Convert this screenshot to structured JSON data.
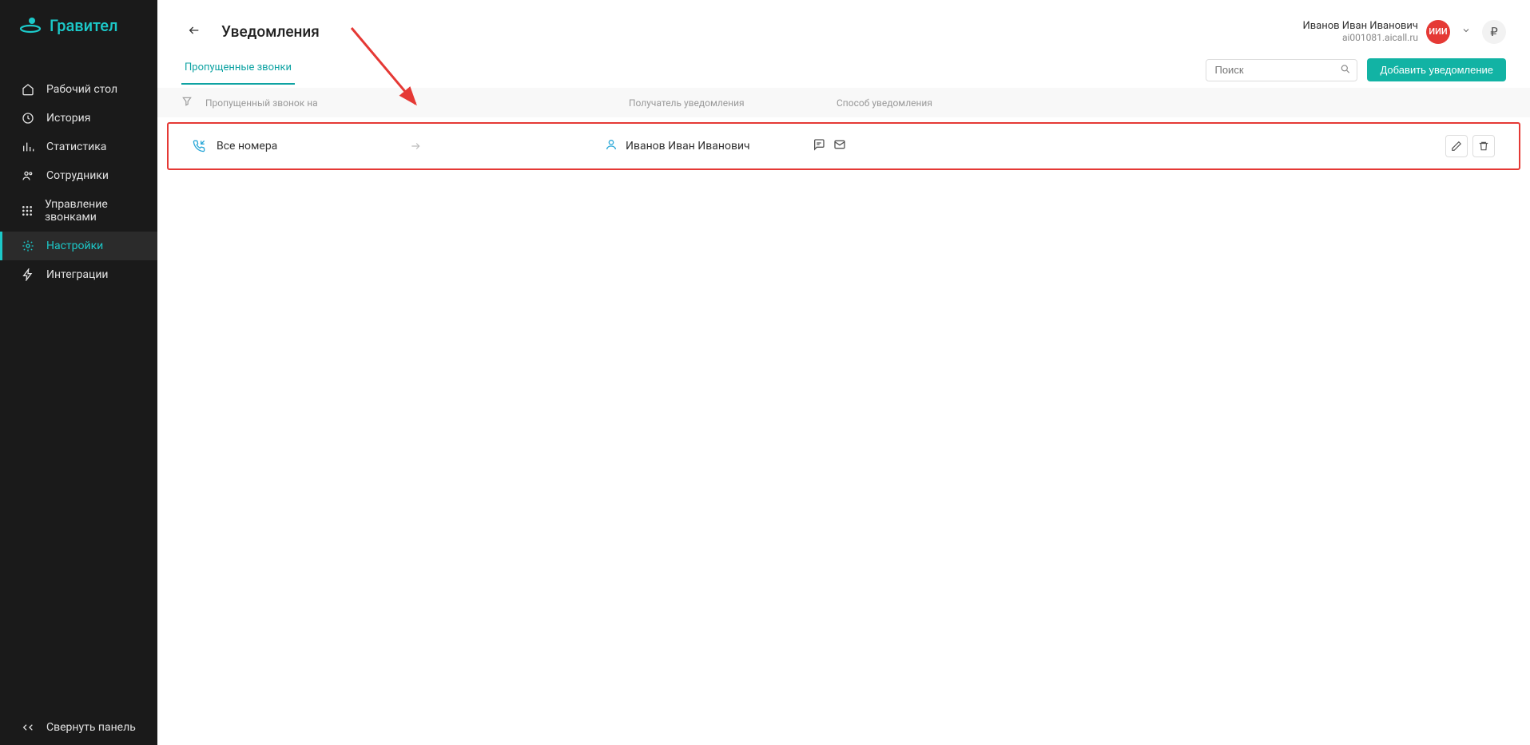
{
  "brand": {
    "name": "Гравител"
  },
  "sidebar": {
    "items": [
      {
        "label": "Рабочий стол"
      },
      {
        "label": "История"
      },
      {
        "label": "Статистика"
      },
      {
        "label": "Сотрудники"
      },
      {
        "label": "Управление звонками"
      },
      {
        "label": "Настройки"
      },
      {
        "label": "Интеграции"
      }
    ],
    "collapse_label": "Свернуть панель"
  },
  "header": {
    "page_title": "Уведомления",
    "user_name": "Иванов Иван Иванович",
    "user_domain": "ai001081.aicall.ru",
    "avatar_initials": "ИИИ",
    "currency_symbol": "₽"
  },
  "tabs": [
    {
      "label": "Пропущенные звонки",
      "active": true
    }
  ],
  "search": {
    "placeholder": "Поиск"
  },
  "buttons": {
    "add_notification": "Добавить уведомление"
  },
  "table": {
    "headers": {
      "missed_call_to": "Пропущенный звонок на",
      "recipient": "Получатель уведомления",
      "method": "Способ уведомления"
    },
    "rows": [
      {
        "missed_to": "Все номера",
        "recipient": "Иванов Иван Иванович",
        "methods": [
          "sms",
          "email"
        ]
      }
    ]
  }
}
